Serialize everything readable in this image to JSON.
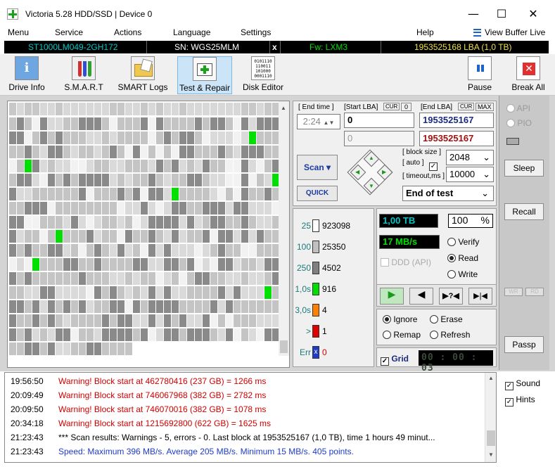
{
  "window": {
    "title": "Victoria 5.28 HDD/SSD | Device 0",
    "min": "—",
    "max": "☐",
    "close": "✕"
  },
  "menu": [
    "Menu",
    "Service",
    "Actions",
    "Language",
    "Settings",
    "Help"
  ],
  "view_buffer": "View Buffer Live",
  "info": {
    "model": "ST1000LM049-2GH172",
    "serial": "SN: WGS25MLM",
    "x": "x",
    "firmware": "Fw: LXM3",
    "lba": "1953525168 LBA (1,0 TB)"
  },
  "toolbar": {
    "drive_info": "Drive Info",
    "smart": "S.M.A.R.T",
    "smart_logs": "SMART Logs",
    "test_repair": "Test & Repair",
    "disk_editor": "Disk Editor",
    "pause": "Pause",
    "break_all": "Break All",
    "binary": "0101110\n110011\n101000\n0001110"
  },
  "test": {
    "end_time_label": "[ End time ]",
    "end_time": "2:24",
    "start_lba_label": "[Start LBA]",
    "cur": "CUR",
    "start_cur": "0",
    "end_lba_label": "[End LBA]",
    "max": "MAX",
    "start_lba": "0",
    "end_lba": "1953525167",
    "start_lba2": "0",
    "end_lba2": "1953525167",
    "block_size_label": "[ block size ]",
    "auto_label": "[ auto ]",
    "timeout_label": "[ timeout,ms ]",
    "block_size": "2048",
    "timeout": "10000",
    "scan": "Scan",
    "quick": "QUICK",
    "end_mode": "End of test"
  },
  "legend": [
    {
      "label": "25",
      "count": "923098",
      "color": "#ffffff"
    },
    {
      "label": "100",
      "count": "25350",
      "color": "#c0c0c0"
    },
    {
      "label": "250",
      "count": "4502",
      "color": "#808080"
    },
    {
      "label": "1,0s",
      "count": "916",
      "color": "#00e000"
    },
    {
      "label": "3,0s",
      "count": "4",
      "color": "#ff8000"
    },
    {
      "label": ">",
      "count": "1",
      "color": "#e00000"
    },
    {
      "label": "Err",
      "count": "0",
      "color": "#1e3cc8"
    }
  ],
  "stats": {
    "size": "1,00 TB",
    "percent": "100",
    "pct_sign": "%",
    "speed": "17 MB/s",
    "ddd": "DDD (API)",
    "verify": "Verify",
    "read": "Read",
    "write": "Write",
    "ignore": "Ignore",
    "erase": "Erase",
    "remap": "Remap",
    "refresh": "Refresh",
    "grid": "Grid",
    "timer": "00 : 00 : 03"
  },
  "side": {
    "api": "API",
    "pio": "PIO",
    "sleep": "Sleep",
    "recall": "Recall",
    "wr": "WR",
    "rd": "RD",
    "passp": "Passp",
    "sound": "Sound",
    "hints": "Hints"
  },
  "log": [
    {
      "time": "19:56:50",
      "text": "Warning! Block start at 462780416 (237 GB)  = 1266 ms",
      "color": "#d00000"
    },
    {
      "time": "20:09:49",
      "text": "Warning! Block start at 746067968 (382 GB)  = 2782 ms",
      "color": "#d00000"
    },
    {
      "time": "20:09:50",
      "text": "Warning! Block start at 746070016 (382 GB)  = 1078 ms",
      "color": "#d00000"
    },
    {
      "time": "20:34:18",
      "text": "Warning! Block start at 1215692800 (622 GB)  = 1625 ms",
      "color": "#d00000"
    },
    {
      "time": "21:23:43",
      "text": "*** Scan results: Warnings - 5, errors - 0. Last block at 1953525167 (1,0 TB), time 1 hours 49 minut...",
      "color": "#000000"
    },
    {
      "time": "21:23:43",
      "text": "Speed: Maximum 396 MB/s. Average 205 MB/s. Minimum 15 MB/s. 405 points.",
      "color": "#1e3cc8"
    }
  ]
}
